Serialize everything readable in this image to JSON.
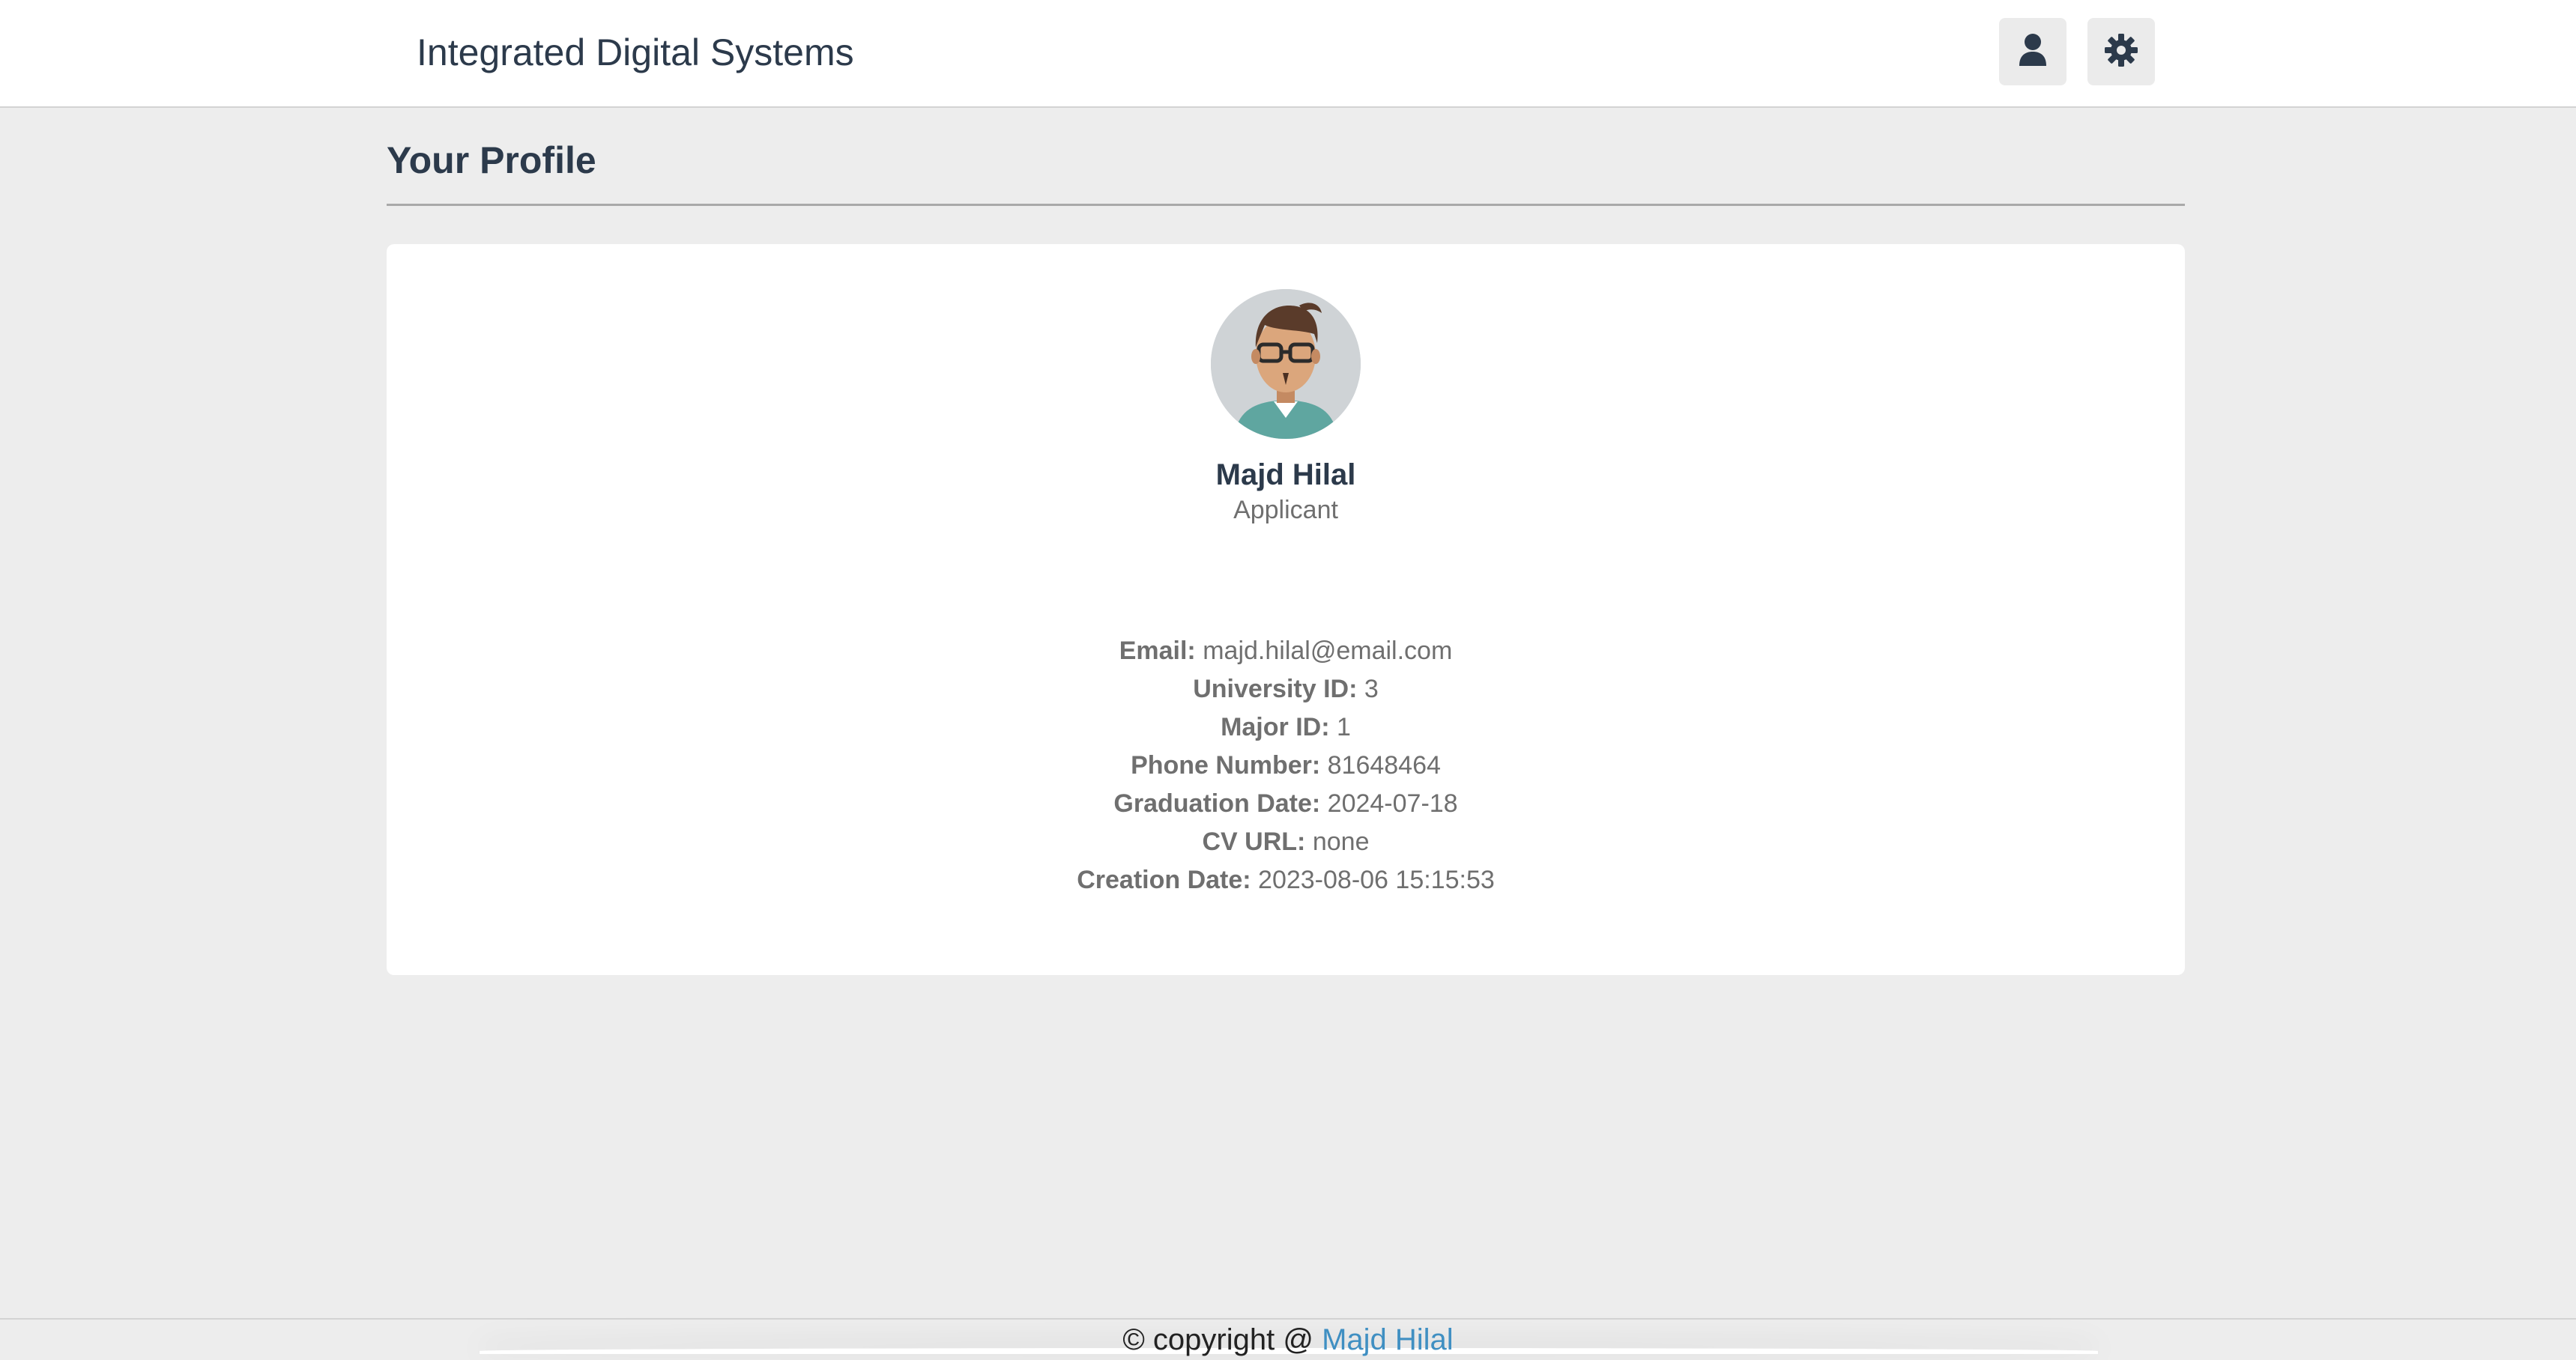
{
  "header": {
    "brand": "Integrated Digital Systems",
    "icons": [
      "user-icon",
      "gear-icon"
    ]
  },
  "page": {
    "title": "Your Profile"
  },
  "profile": {
    "avatar_icon": "avatar-illustration",
    "name": "Majd Hilal",
    "role": "Applicant",
    "details": [
      {
        "label": "Email:",
        "value": "majd.hilal@email.com"
      },
      {
        "label": "University ID:",
        "value": "3"
      },
      {
        "label": "Major ID:",
        "value": "1"
      },
      {
        "label": "Phone Number:",
        "value": "81648464"
      },
      {
        "label": "Graduation Date:",
        "value": "2024-07-18"
      },
      {
        "label": "CV URL:",
        "value": "none"
      },
      {
        "label": "Creation Date:",
        "value": "2023-08-06 15:15:53"
      }
    ]
  },
  "footer": {
    "prefix": "© copyright @ ",
    "link_label": "Majd Hilal"
  },
  "colors": {
    "text_dark": "#2c3a4b",
    "text_muted": "#6f6f6f",
    "link": "#3f8fc2",
    "background": "#ededed"
  }
}
